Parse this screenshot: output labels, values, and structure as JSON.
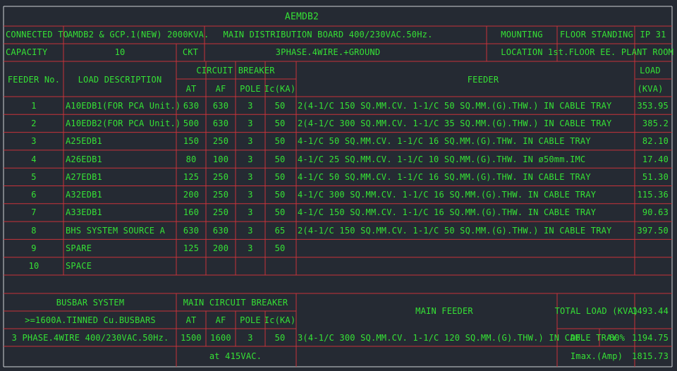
{
  "title": "AEMDB2",
  "header": {
    "connected_to_label": "CONNECTED TO",
    "connected_to_value": "AMDB2 & GCP.1(NEW) 2000KVA.",
    "board_desc": "MAIN DISTRIBUTION BOARD 400/230VAC.50Hz.",
    "mounting_label": "MOUNTING",
    "mounting_value": "FLOOR STANDING",
    "ip_rating": "IP 31",
    "capacity_label": "CAPACITY",
    "capacity_value": "10",
    "ckt_label": "CKT",
    "system_desc": "3PHASE.4WIRE.+GROUND",
    "location_label": "LOCATION",
    "location_value": "1st.FLOOR EE. PLANT ROOM"
  },
  "columns": {
    "feeder_no": "FEEDER No.",
    "load_desc": "LOAD DESCRIPTION",
    "circuit_breaker": "CIRCUIT BREAKER",
    "at": "AT",
    "af": "AF",
    "pole": "POLE",
    "ic": "Ic(KA)",
    "feeder": "FEEDER",
    "load_top": "LOAD",
    "load_unit": "(KVA)"
  },
  "rows": [
    {
      "no": "1",
      "desc": "A10EDB1(FOR PCA Unit.)",
      "at": "630",
      "af": "630",
      "pole": "3",
      "ic": "50",
      "feeder": "2(4-1/C 150 SQ.MM.CV. 1-1/C 50 SQ.MM.(G).THW.) IN CABLE TRAY",
      "load": "353.95"
    },
    {
      "no": "2",
      "desc": "A10EDB2(FOR PCA Unit.)",
      "at": "500",
      "af": "630",
      "pole": "3",
      "ic": "50",
      "feeder": "2(4-1/C 300 SQ.MM.CV. 1-1/C 35 SQ.MM.(G).THW.) IN CABLE TRAY",
      "load": "385.2"
    },
    {
      "no": "3",
      "desc": "A25EDB1",
      "at": "150",
      "af": "250",
      "pole": "3",
      "ic": "50",
      "feeder": "4-1/C 50 SQ.MM.CV. 1-1/C 16 SQ.MM.(G).THW. IN CABLE TRAY",
      "load": "82.10"
    },
    {
      "no": "4",
      "desc": "A26EDB1",
      "at": "80",
      "af": "100",
      "pole": "3",
      "ic": "50",
      "feeder": "4-1/C 25 SQ.MM.CV. 1-1/C 10 SQ.MM.(G).THW. IN ø50mm.IMC",
      "load": "17.40"
    },
    {
      "no": "5",
      "desc": "A27EDB1",
      "at": "125",
      "af": "250",
      "pole": "3",
      "ic": "50",
      "feeder": "4-1/C 50 SQ.MM.CV. 1-1/C 16 SQ.MM.(G).THW. IN CABLE TRAY",
      "load": "51.30"
    },
    {
      "no": "6",
      "desc": "A32EDB1",
      "at": "200",
      "af": "250",
      "pole": "3",
      "ic": "50",
      "feeder": "4-1/C 300 SQ.MM.CV. 1-1/C 16 SQ.MM.(G).THW. IN CABLE TRAY",
      "load": "115.36"
    },
    {
      "no": "7",
      "desc": "A33EDB1",
      "at": "160",
      "af": "250",
      "pole": "3",
      "ic": "50",
      "feeder": "4-1/C 150 SQ.MM.CV. 1-1/C 16 SQ.MM.(G).THW. IN CABLE TRAY",
      "load": "90.63"
    },
    {
      "no": "8",
      "desc": "BHS SYSTEM SOURCE A",
      "at": "630",
      "af": "630",
      "pole": "3",
      "ic": "65",
      "feeder": "2(4-1/C 150 SQ.MM.CV. 1-1/C 50 SQ.MM.(G).THW.) IN CABLE TRAY",
      "load": "397.50"
    },
    {
      "no": "9",
      "desc": "SPARE",
      "at": "125",
      "af": "200",
      "pole": "3",
      "ic": "50",
      "feeder": "",
      "load": ""
    },
    {
      "no": "10",
      "desc": "SPACE",
      "at": "",
      "af": "",
      "pole": "",
      "ic": "",
      "feeder": "",
      "load": ""
    }
  ],
  "footer": {
    "busbar_title": "BUSBAR SYSTEM",
    "busbar_spec": ">=1600A.TINNED Cu.BUSBARS",
    "busbar_system": "3 PHASE.4WIRE  400/230VAC.50Hz.",
    "mcb_title": "MAIN CIRCUIT BREAKER",
    "at_label": "AT",
    "af_label": "AF",
    "pole_label": "POLE",
    "ic_label": "Ic(KA)",
    "mcb_at": "1500",
    "mcb_af": "1600",
    "mcb_pole": "3",
    "mcb_ic": "50",
    "mcb_note": "at 415VAC.",
    "main_feeder_title": "MAIN FEEDER",
    "main_feeder_value": "3(4-1/C 300 SQ.MM.CV. 1-1/C 120 SQ.MM.(G).THW.) IN CABLE TRAY",
    "total_load_label": "TOTAL LOAD (KVA)",
    "total_load_value": "1493.44",
    "df_label": "DF.",
    "df_value": "80%",
    "df_load_value": "1194.75",
    "imax_label": "Imax.(Amp)",
    "imax_value": "1815.73"
  },
  "colors": {
    "text": "#35e135",
    "grid": "#c8333a",
    "background": "#252a33",
    "frame": "#cfd3d6"
  }
}
